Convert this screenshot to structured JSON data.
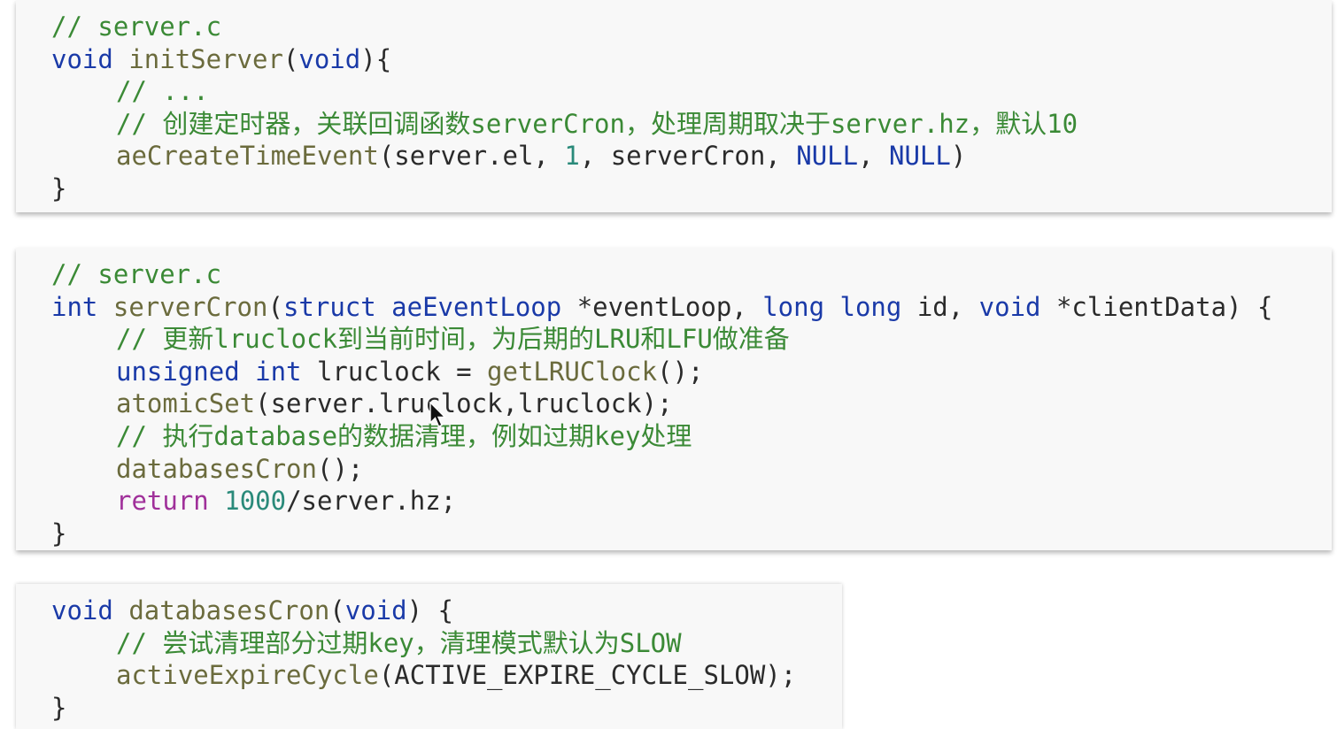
{
  "block1": {
    "line1": "// server.c",
    "line2": {
      "kw": "void",
      "fn": "initServer",
      "open": "(",
      "arg": "void",
      "close": "){"
    },
    "line3": "// ...",
    "line4": "// 创建定时器，关联回调函数serverCron，处理周期取决于server.hz，默认10",
    "line5": {
      "fn": "aeCreateTimeEvent",
      "a": "(server.el, ",
      "num": "1",
      "b": ", serverCron, ",
      "null1": "NULL",
      "c": ", ",
      "null2": "NULL",
      "d": ")"
    },
    "line6": "}"
  },
  "block2": {
    "line1": "// server.c",
    "line2": {
      "kw": "int",
      "fn": "serverCron",
      "a": "(",
      "kw2": "struct",
      "type": "aeEventLoop",
      "b": " *eventLoop, ",
      "kw3": "long long",
      "c": " id, ",
      "kw4": "void",
      "d": " *clientData) {"
    },
    "line3": "// 更新lruclock到当前时间，为后期的LRU和LFU做准备",
    "line4": {
      "kw": "unsigned int",
      "a": " lruclock = ",
      "fn": "getLRUClock",
      "b": "();"
    },
    "line5": {
      "fn": "atomicSet",
      "a": "(server.lruclock,lruclock);"
    },
    "line6": "// 执行database的数据清理，例如过期key处理",
    "line7": {
      "fn": "databasesCron",
      "a": "();"
    },
    "line8": {
      "kw": "return",
      "num": "1000",
      "a": "/server.hz;"
    },
    "line9": "}"
  },
  "block3": {
    "line1": {
      "kw": "void",
      "fn": "databasesCron",
      "a": "(",
      "arg": "void",
      "b": ") {"
    },
    "line2": "// 尝试清理部分过期key，清理模式默认为SLOW",
    "line3": {
      "fn": "activeExpireCycle",
      "a": "(ACTIVE_EXPIRE_CYCLE_SLOW);"
    },
    "line4": "}"
  },
  "colors": {
    "comment": "#3b8a36",
    "keyword": "#1a3aa8",
    "function": "#6b6b3d",
    "number": "#2a8a7a",
    "return": "#a0309a",
    "text": "#2b2b2b",
    "background": "#f8f8f8"
  },
  "cursor": {
    "icon": "mouse-pointer-icon"
  }
}
